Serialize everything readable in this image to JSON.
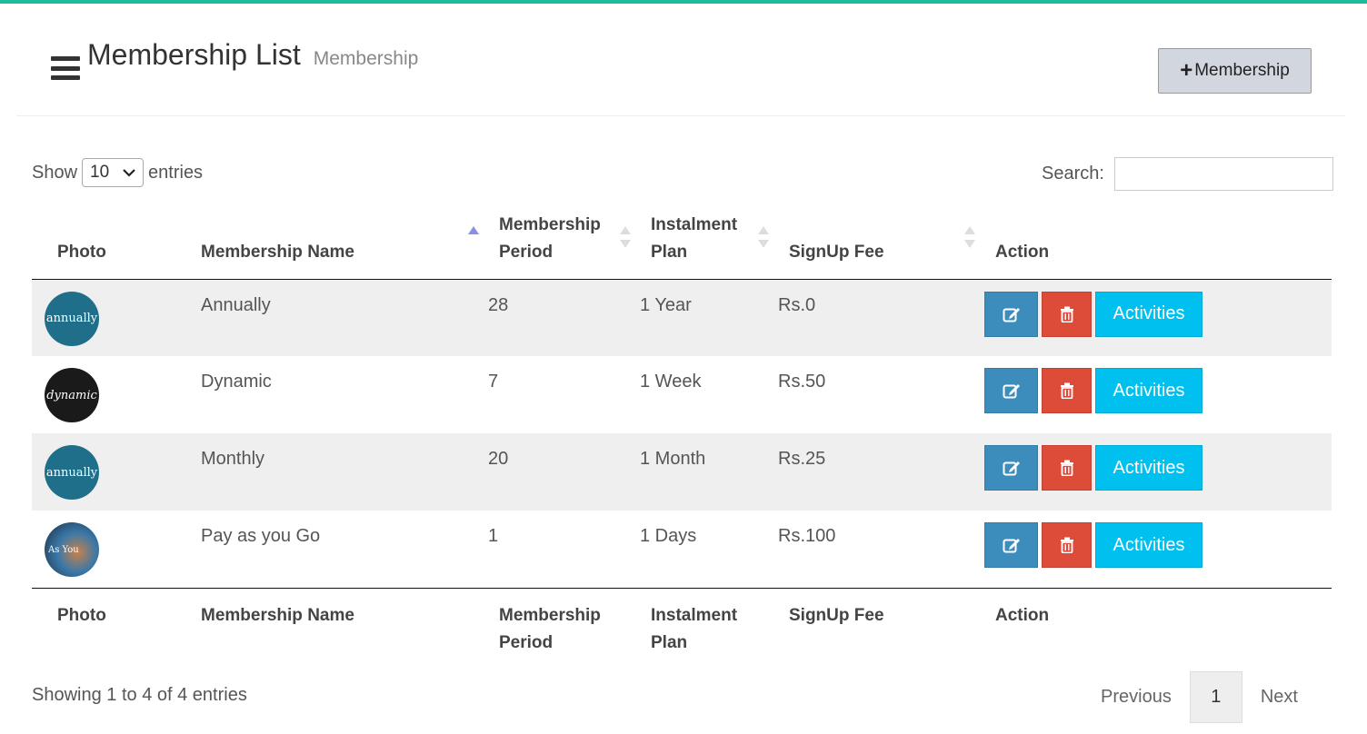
{
  "header": {
    "title": "Membership List",
    "subtitle": "Membership",
    "add_button_label": "Membership"
  },
  "controls": {
    "show_label": "Show",
    "page_size": "10",
    "entries_label": "entries",
    "search_label": "Search:",
    "search_value": ""
  },
  "table": {
    "columns": {
      "photo": "Photo",
      "name": "Membership Name",
      "period": "Membership Period",
      "plan": "Instalment Plan",
      "fee": "SignUp Fee",
      "action": "Action"
    },
    "rows": [
      {
        "photo_text": "annually",
        "name": "Annually",
        "period": "28",
        "plan": "1 Year",
        "fee": "Rs.0",
        "activities_label": "Activities"
      },
      {
        "photo_text": "dynamic",
        "name": "Dynamic",
        "period": "7",
        "plan": "1 Week",
        "fee": "Rs.50",
        "activities_label": "Activities"
      },
      {
        "photo_text": "annually",
        "name": "Monthly",
        "period": "20",
        "plan": "1 Month",
        "fee": "Rs.25",
        "activities_label": "Activities"
      },
      {
        "photo_text": "As You",
        "name": "Pay as you Go",
        "period": "1",
        "plan": "1 Days",
        "fee": "Rs.100",
        "activities_label": "Activities"
      }
    ]
  },
  "footer": {
    "info": "Showing 1 to 4 of 4 entries",
    "previous_label": "Previous",
    "current_page": "1",
    "next_label": "Next"
  },
  "colors": {
    "accent_bar": "#1abc9c",
    "edit": "#3c8dbc",
    "delete": "#dd4b39",
    "activities": "#00c0ef"
  },
  "icons": {
    "menu": "hamburger-icon",
    "add": "plus-icon",
    "edit": "edit-icon",
    "delete": "trash-icon",
    "select": "chevron-down-icon",
    "sort": "sort-icon"
  }
}
